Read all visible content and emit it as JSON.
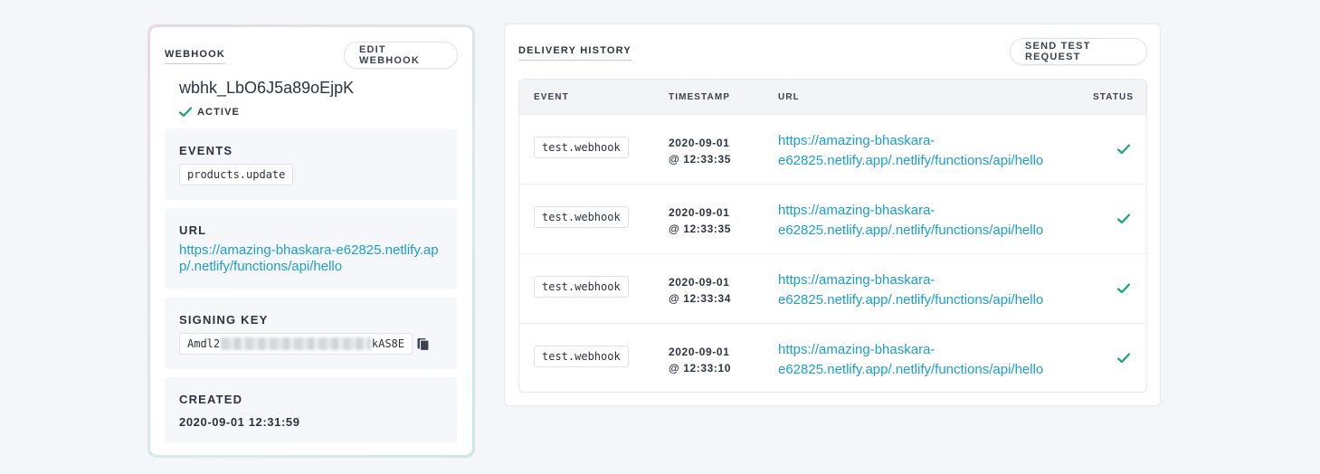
{
  "webhook": {
    "heading": "WEBHOOK",
    "edit_button": "EDIT WEBHOOK",
    "id": "wbhk_LbO6J5a89oEjpK",
    "status": "ACTIVE",
    "events_label": "EVENTS",
    "events": [
      "products.update"
    ],
    "url_label": "URL",
    "url_line1": "https://amazing-bhaskara-e62825.netlify.ap",
    "url_line2": "p/.netlify/functions/api/hello",
    "signing_key_label": "SIGNING KEY",
    "signing_key_prefix": "Amdl2",
    "signing_key_suffix": "kAS8E",
    "created_label": "CREATED",
    "created_value": "2020-09-01 12:31:59"
  },
  "delivery": {
    "heading": "DELIVERY HISTORY",
    "send_button": "SEND TEST REQUEST",
    "columns": {
      "event": "EVENT",
      "timestamp": "TIMESTAMP",
      "url": "URL",
      "status": "STATUS"
    },
    "rows": [
      {
        "event": "test.webhook",
        "date": "2020-09-01",
        "time": "@ 12:33:35",
        "url_line1": "https://amazing-bhaskara-",
        "url_line2": "e62825.netlify.app/.netlify/functions/api/hello",
        "status": "success"
      },
      {
        "event": "test.webhook",
        "date": "2020-09-01",
        "time": "@ 12:33:35",
        "url_line1": "https://amazing-bhaskara-",
        "url_line2": "e62825.netlify.app/.netlify/functions/api/hello",
        "status": "success"
      },
      {
        "event": "test.webhook",
        "date": "2020-09-01",
        "time": "@ 12:33:34",
        "url_line1": "https://amazing-bhaskara-",
        "url_line2": "e62825.netlify.app/.netlify/functions/api/hello",
        "status": "success"
      },
      {
        "event": "test.webhook",
        "date": "2020-09-01",
        "time": "@ 12:33:10",
        "url_line1": "https://amazing-bhaskara-",
        "url_line2": "e62825.netlify.app/.netlify/functions/api/hello",
        "status": "success"
      }
    ]
  },
  "colors": {
    "link": "#1a9fd0",
    "success": "#1aa37a",
    "text": "#2b3340"
  },
  "icons": {
    "status": "check-icon",
    "copy": "copy-icon"
  }
}
